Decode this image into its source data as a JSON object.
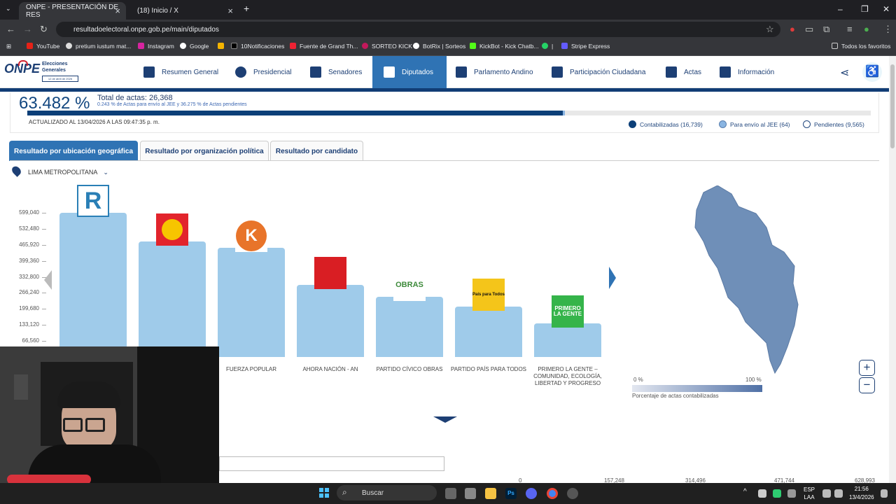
{
  "browser": {
    "tabs": [
      {
        "label": "ONPE - PRESENTACIÓN DE RES",
        "active": true
      },
      {
        "label": "(18) Inicio / X",
        "active": false
      }
    ],
    "url": "resultadoelectoral.onpe.gob.pe/main/diputados",
    "bookmarks": [
      "YouTube",
      "pretium iustum mat...",
      "Instagram",
      "Google",
      "10Notificaciones",
      "Fuente de Grand Th...",
      "SORTEO KICK",
      "BotRix | Sorteos",
      "KickBot - Kick Chatb...",
      "|",
      "Stripe Express"
    ],
    "all_favorites": "Todos los favoritos"
  },
  "site": {
    "logo_text": "ONPE",
    "logo_sub": "Elecciones Generales",
    "logo_date": "12 de abril de 2026",
    "menu": [
      "Resumen General",
      "Presidencial",
      "Senadores",
      "Diputados",
      "Parlamento Andino",
      "Participación Ciudadana",
      "Actas",
      "Información"
    ],
    "active_menu": "Diputados"
  },
  "summary": {
    "percent": "63.482 %",
    "total_actas": "Total de actas: 26,368",
    "sub": "0.243 % de Actas para envío al JEE y 36.275 % de Actas pendientes",
    "updated": "ACTUALIZADO AL 13/04/2026 A LAS 09:47:35 p. m.",
    "progress_counted": 63.482,
    "progress_jee": 0.243,
    "legend": [
      "Contabilizadas (16,739)",
      "Para envío al JEE (64)",
      "Pendientes (9,565)"
    ],
    "legend_colors": [
      "#0c3f78",
      "#8ab5e2",
      "#ffffff"
    ]
  },
  "tabs": [
    "Resultado por ubicación geográfica",
    "Resultado por organización política",
    "Resultado por candidato"
  ],
  "location": "LIMA METROPOLITANA",
  "chart_data": {
    "type": "bar",
    "y_ticks": [
      "599,040",
      "532,480",
      "465,920",
      "399,360",
      "332,800",
      "266,240",
      "199,680",
      "133,120",
      "66,560"
    ],
    "categories": [
      "",
      "",
      "FUERZA POPULAR",
      "AHORA NACIÓN - AN",
      "PARTIDO CÍVICO OBRAS",
      "PARTIDO PAÍS PARA TODOS",
      "PRIMERO LA GENTE – COMUNIDAD, ECOLOGÍA, LIBERTAD Y PROGRESO"
    ],
    "values": [
      599040,
      480000,
      455000,
      300000,
      250000,
      208000,
      140000
    ],
    "logo_texts": [
      "R",
      "",
      "K",
      "",
      "OBRAS",
      "País para Todos",
      "PRIMERO LA GENTE"
    ]
  },
  "map": {
    "min_label": "0 %",
    "max_label": "100 %",
    "caption": "Porcentaje de actas contabilizadas"
  },
  "bottom_axis": [
    "0",
    "157,248",
    "314,496",
    "471,744",
    "628,993"
  ],
  "taskbar": {
    "search": "Buscar",
    "lang1": "ESP",
    "lang2": "LAA",
    "time": "21:56",
    "date": "13/4/2026"
  }
}
